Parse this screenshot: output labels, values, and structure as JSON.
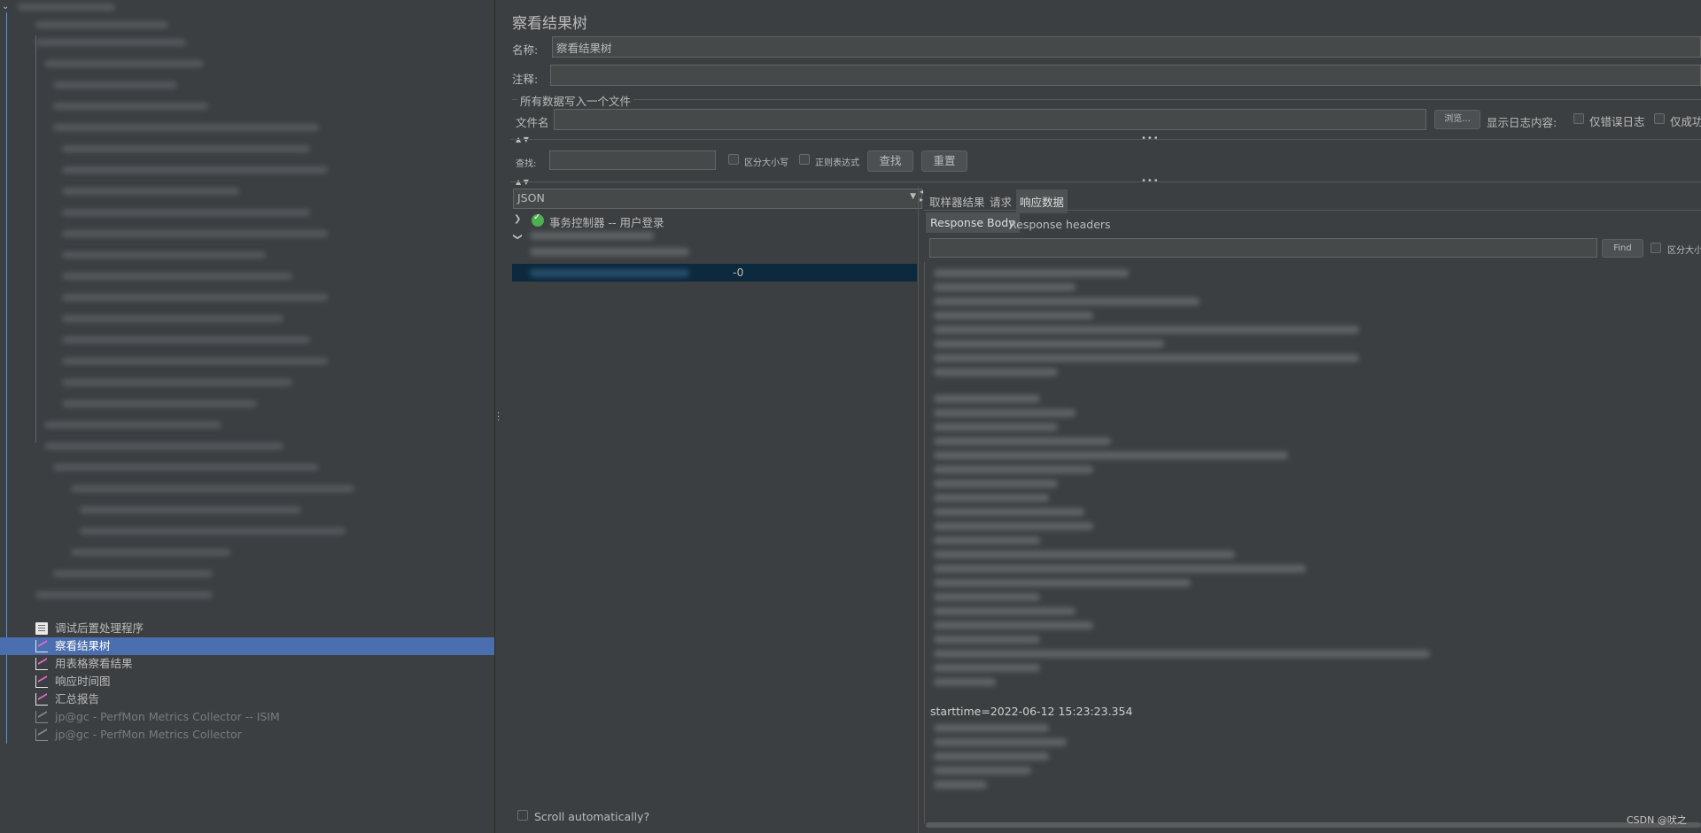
{
  "tree": {
    "items": [
      {
        "label": "调试后置处理程序",
        "icon": "debug-postprocessor-icon"
      },
      {
        "label": "察看结果树",
        "icon": "graph-icon",
        "selected": true
      },
      {
        "label": "用表格察看结果",
        "icon": "graph-icon"
      },
      {
        "label": "响应时间图",
        "icon": "graph-icon"
      },
      {
        "label": "汇总报告",
        "icon": "graph-icon"
      },
      {
        "label": "jp@gc - PerfMon Metrics Collector -- ISIM",
        "icon": "graph-icon",
        "disabled": true
      },
      {
        "label": "jp@gc - PerfMon Metrics Collector",
        "icon": "graph-icon",
        "disabled": true
      }
    ]
  },
  "panel": {
    "title": "察看结果树",
    "name_label": "名称:",
    "name_value": "察看结果树",
    "comment_label": "注释:",
    "comment_value": "",
    "file_group_label": "所有数据写入一个文件",
    "filename_label": "文件名",
    "filename_value": "",
    "browse_button": "浏览...",
    "log_display_label": "显示日志内容:",
    "errors_only_label": "仅错误日志",
    "success_only_label": "仅成功"
  },
  "search": {
    "label": "查找:",
    "value": "",
    "case_sensitive_label": "区分大小写",
    "regex_label": "正则表达式",
    "find_button": "查找",
    "reset_button": "重置"
  },
  "renderer": {
    "selected": "JSON"
  },
  "results": {
    "transaction_label": "事务控制器 -- 用户登录",
    "selected_suffix": "-0",
    "scroll_auto_label": "Scroll automatically?"
  },
  "tabs": {
    "sampler_result": "取样器结果",
    "request": "请求",
    "response_data": "响应数据"
  },
  "subtabs": {
    "response_body": "Response Body",
    "response_headers": "Response headers"
  },
  "response_search": {
    "value": "",
    "find_button": "Find",
    "case_label": "区分大小"
  },
  "response": {
    "starttime_line": "starttime=2022-06-12 15:23:23.354"
  },
  "watermark": "CSDN @吠之"
}
